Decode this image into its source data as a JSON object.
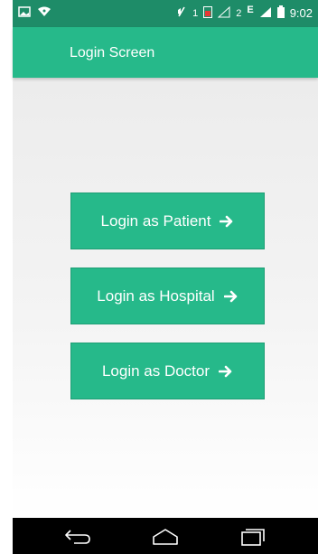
{
  "status_bar": {
    "time": "9:02",
    "signal_labels": [
      "1",
      "2",
      "E"
    ],
    "icons": [
      "image-icon",
      "wifi-icon",
      "mute-icon",
      "sim1-icon",
      "signal-icon",
      "battery-icon"
    ]
  },
  "app_bar": {
    "title": "Login Screen"
  },
  "buttons": {
    "patient_label": "Login as Patient",
    "hospital_label": "Login as Hospital",
    "doctor_label": "Login as Doctor"
  },
  "nav_bar": {
    "icons": [
      "back-icon",
      "home-icon",
      "recents-icon"
    ]
  },
  "colors": {
    "primary": "#26b98a",
    "primary_dark": "#1e8c68",
    "nav_bar": "#000000"
  }
}
